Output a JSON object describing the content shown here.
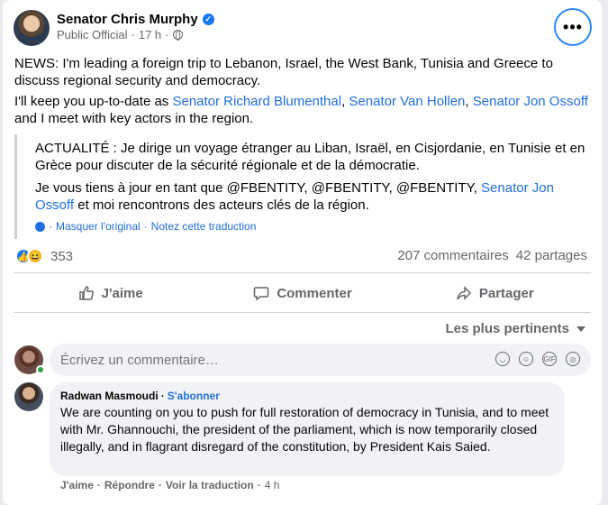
{
  "post": {
    "author": "Senator Chris Murphy",
    "role": "Public Official",
    "time": "17 h",
    "more_label": "•••",
    "p1": "NEWS: I'm leading a foreign trip to Lebanon, Israel, the West Bank, Tunisia and Greece to discuss regional security and democracy.",
    "p2_prefix": "I'll keep you up-to-date as ",
    "mention1": "Senator Richard Blumenthal",
    "sep1": ", ",
    "mention2": "Senator Van Hollen",
    "sep2": ", ",
    "mention3": "Senator Jon Ossoff",
    "p2_suffix": " and I meet with key actors in the region."
  },
  "translation": {
    "t1": "ACTUALITÉ : Je dirige un voyage étranger au Liban, Israël, en Cisjordanie, en Tunisie et en Grèce pour discuter de la sécurité régionale et de la démocratie.",
    "t2_prefix": "Je vous tiens à jour en tant que @FBENTITY, @FBENTITY, @FBENTITY, ",
    "t2_link": "Senator Jon Ossoff",
    "t2_suffix": " et moi rencontrons des acteurs clés de la région.",
    "hide_original": "Masquer l'original",
    "rate": "Notez cette traduction",
    "dot": "·"
  },
  "engagement": {
    "reaction_count": "353",
    "comments": "207 commentaires",
    "shares": "42 partages"
  },
  "actions": {
    "like": "J'aime",
    "comment": "Commenter",
    "share": "Partager"
  },
  "sort_label": "Les plus pertinents",
  "comment_box": {
    "placeholder": "Écrivez un commentaire…"
  },
  "comment": {
    "author": "Radwan Masmoudi",
    "dot": "·",
    "follow": "S'abonner",
    "text": "We are counting on you to push for full restoration of democracy in Tunisia, and to meet with Mr. Ghannouchi, the president of the parliament, which is now temporarily closed illegally, and in flagrant disregard of the constitution, by President Kais Saied.",
    "like": "J'aime",
    "reply": "Répondre",
    "see_translation": "Voir la traduction",
    "time": "4 h",
    "dot2": "·"
  },
  "colors": {
    "link": "#216fdb",
    "brand": "#1877f2",
    "secondary_text": "#65676b"
  }
}
